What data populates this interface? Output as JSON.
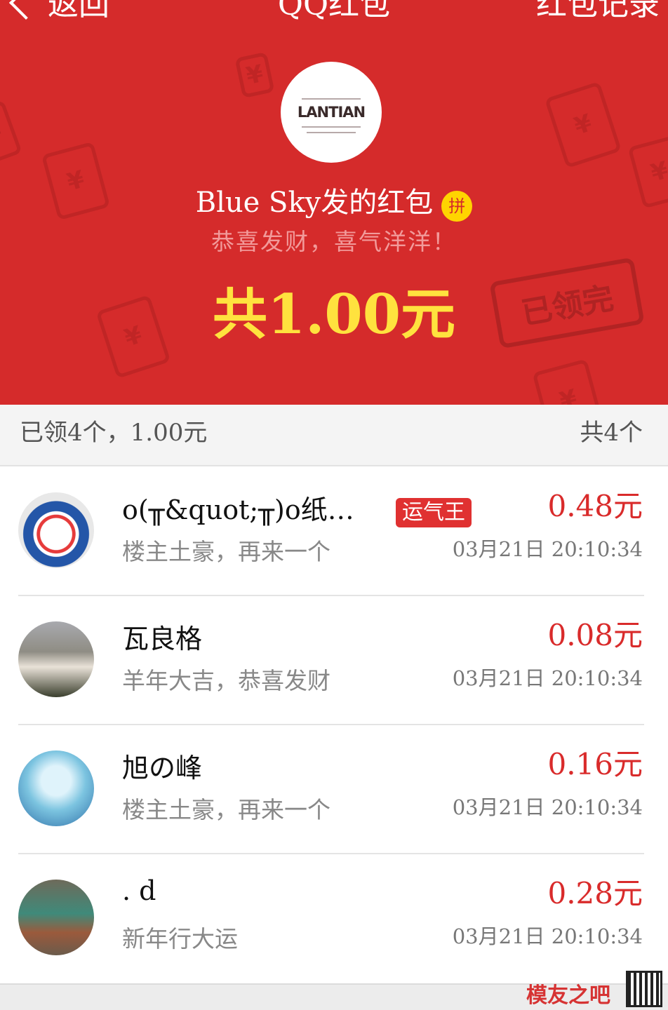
{
  "topbar": {
    "back_label": "返回",
    "title": "QQ红包",
    "records_label": "红包记录"
  },
  "packet": {
    "sender_label": "Blue Sky发的红包",
    "type_badge": "拼",
    "blessing": "恭喜发财，喜气洋洋！",
    "total": "共1.00元",
    "status_stamp": "已领完",
    "avatar_logo": "LANTIAN"
  },
  "summary": {
    "claimed": "已领4个，1.00元",
    "total_count": "共4个"
  },
  "records": [
    {
      "name": "o(╥&quot;╥)o纸…",
      "message": "楼主土豪，再来一个",
      "amount": "0.48元",
      "time": "03月21日 20:10:34",
      "badge": "运气王"
    },
    {
      "name": "瓦良格",
      "message": "羊年大吉，恭喜发财",
      "amount": "0.08元",
      "time": "03月21日 20:10:34"
    },
    {
      "name": "旭の峰",
      "message": "楼主土豪，再来一个",
      "amount": "0.16元",
      "time": "03月21日 20:10:34"
    },
    {
      "name": ". d",
      "message": "新年行大运",
      "amount": "0.28元",
      "time": "03月21日 20:10:34"
    }
  ],
  "watermark": {
    "text": "模友之吧"
  },
  "colors": {
    "header_red": "#d52b2b",
    "amount_red": "#d92b2b",
    "gold": "#ffe23e",
    "badge_yellow": "#ffd400"
  }
}
